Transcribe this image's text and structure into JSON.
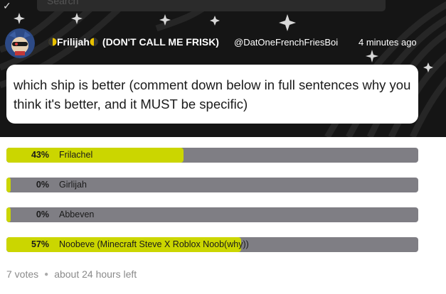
{
  "search": {
    "placeholder": "Search"
  },
  "post": {
    "author_name": "Frilijah",
    "author_suffix": "(DON'T CALL ME FRISK)",
    "handle": "@DatOneFrenchFriesBoi",
    "time": "4 minutes ago",
    "question": "which ship is better (comment down below in full sentences why you think it's better, and it MUST be specific)"
  },
  "poll": {
    "options": [
      {
        "percent_label": "43%",
        "percent": 43,
        "label": "Frilachel"
      },
      {
        "percent_label": "0%",
        "percent": 0,
        "label": "Girlijah"
      },
      {
        "percent_label": "0%",
        "percent": 0,
        "label": "Abbeven"
      },
      {
        "percent_label": "57%",
        "percent": 57,
        "label": "Noobeve (Minecraft Steve X Roblox Noob(why))"
      }
    ],
    "votes": "7 votes",
    "time_left": "about 24 hours left"
  },
  "colors": {
    "fill": "#cbd600",
    "track": "#7f7e84",
    "banner": "#151515"
  },
  "icons": [
    "chevron-icon",
    "avatar",
    "half-moon-icon",
    "sparkle-icon"
  ]
}
